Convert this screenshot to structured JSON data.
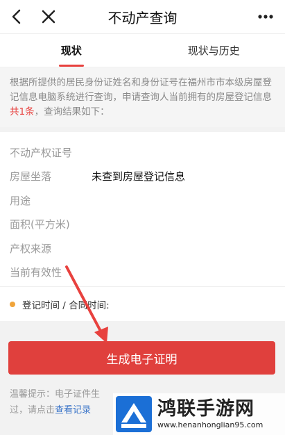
{
  "navbar": {
    "title": "不动产查询"
  },
  "tabs": [
    {
      "label": "现状",
      "active": true
    },
    {
      "label": "现状与历史",
      "active": false
    }
  ],
  "notice": {
    "text_before": "根据所提供的居民身份证姓名和身份证号在福州市市本级房屋登记信息电脑系统进行查询，申请查询人当前拥有的房屋登记信息",
    "highlight": "共1条",
    "text_after": "，查询结果如下："
  },
  "fields": [
    {
      "label": "不动产权证号",
      "value": ""
    },
    {
      "label": "房屋坐落",
      "value": "未查到房屋登记信息"
    },
    {
      "label": "用途",
      "value": ""
    },
    {
      "label": "面积(平方米)",
      "value": ""
    },
    {
      "label": "产权来源",
      "value": ""
    },
    {
      "label": "当前有效性",
      "value": ""
    }
  ],
  "date_label": "登记时间 / 合同时间:",
  "generate_button": "生成电子证明",
  "tip": {
    "line1": "温馨提示：电子证件生",
    "line2_before": "过，请点击",
    "link": "查看记录"
  },
  "watermark": {
    "title": "鸿联手游网",
    "url": "www.henanhonglian95.com"
  },
  "colors": {
    "accent": "#e0403d",
    "highlight": "#e8413e",
    "link": "#3a74c8",
    "dot": "#f0a43a"
  }
}
